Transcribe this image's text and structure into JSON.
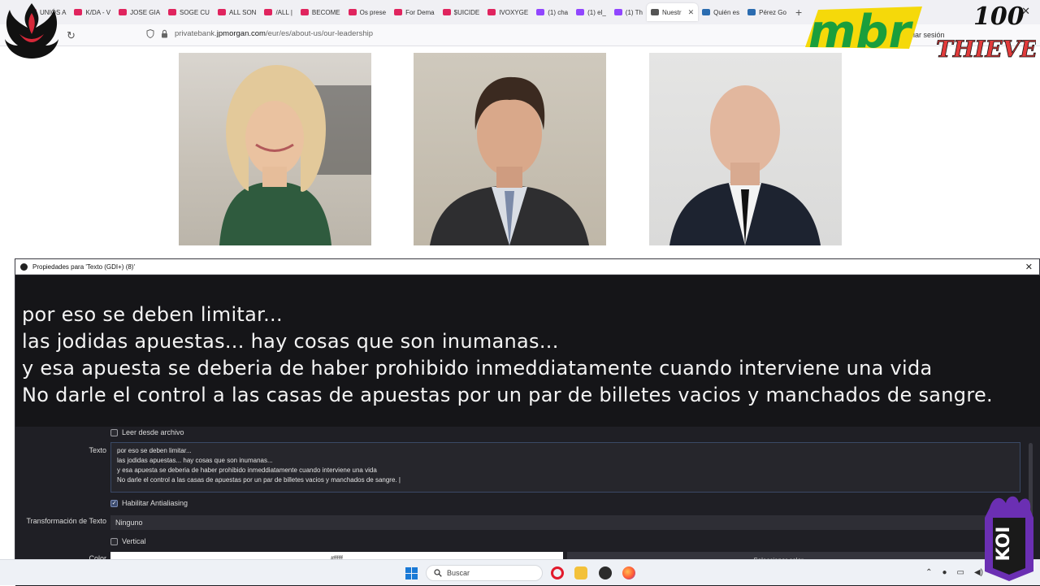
{
  "browser": {
    "tabs": [
      {
        "label": "UNIÓS A",
        "color": "#e0245e"
      },
      {
        "label": "K/DA - V",
        "color": "#e0245e"
      },
      {
        "label": "JOSE GIA",
        "color": "#e0245e"
      },
      {
        "label": "SOGE CU",
        "color": "#e0245e"
      },
      {
        "label": "ALL SON",
        "color": "#e0245e"
      },
      {
        "label": "/ALL |",
        "color": "#e0245e"
      },
      {
        "label": "BECOME",
        "color": "#e0245e"
      },
      {
        "label": "Os prese",
        "color": "#e0245e"
      },
      {
        "label": "For Dema",
        "color": "#e0245e"
      },
      {
        "label": "$UICIDE",
        "color": "#e0245e"
      },
      {
        "label": "IVOXYGE",
        "color": "#e0245e"
      },
      {
        "label": "(1) cha",
        "color": "#9146ff"
      },
      {
        "label": "(1) el_",
        "color": "#9146ff"
      },
      {
        "label": "(1) Th",
        "color": "#9146ff"
      }
    ],
    "active_tab": {
      "label": "Nuestr",
      "close": "✕"
    },
    "extra_tabs": [
      {
        "label": "Quién es",
        "color": "#2b6cb0"
      },
      {
        "label": "Pérez Go",
        "color": "#2b6cb0"
      }
    ],
    "new_tab": "+",
    "close_window": "✕",
    "reload_icon": "↻",
    "url_prefix": "privatebank.",
    "url_domain": "jpmorgan.com",
    "url_path": "/eur/es/about-us/our-leadership",
    "login_text": "Iniciar sesión"
  },
  "page": {
    "photos": [
      {
        "alt": "leader-photo-1"
      },
      {
        "alt": "leader-photo-2"
      },
      {
        "alt": "leader-photo-3"
      }
    ]
  },
  "dialog": {
    "title": "Propiedades para 'Texto (GDI+) (8)'",
    "close": "✕",
    "preview_lines": [
      "por eso se deben limitar...",
      "las jodidas apuestas... hay cosas que son inumanas...",
      "y esa apuesta se deberia de haber prohibido inmeddiatamente cuando interviene una vida",
      "No darle el control a las casas de apuestas por un par de billetes vacios y manchados de sangre."
    ],
    "read_from_file_label": "Leer desde archivo",
    "text_label": "Texto",
    "text_lines": [
      "por eso se deben limitar...",
      "las jodidas apuestas... hay cosas que son inumanas...",
      "y esa apuesta se deberia de haber prohibido inmeddiatamente cuando interviene una vida",
      "No darle el control a las casas de apuestas por un par de billetes vacios y manchados de sangre. |"
    ],
    "antialiasing_label": "Habilitar Antialiasing",
    "antialiasing_checked": true,
    "transform_label": "Transformación de Texto",
    "transform_value": "Ninguno",
    "vertical_label": "Vertical",
    "vertical_checked": false,
    "color_label": "Color",
    "color_value": "#ffffff",
    "select_color_label": "Seleccionar color"
  },
  "taskbar": {
    "search_placeholder": "Buscar",
    "tray_icons": [
      "chevron-up-icon",
      "mic-icon",
      "network-icon",
      "volume-icon"
    ]
  },
  "overlays": {
    "left_logo": "flame-emblem-logo",
    "mbr_logo": "mbr",
    "hundred_thieves_top": "100",
    "hundred_thieves_bottom": "THIEVES",
    "koi_logo": "KOI"
  }
}
